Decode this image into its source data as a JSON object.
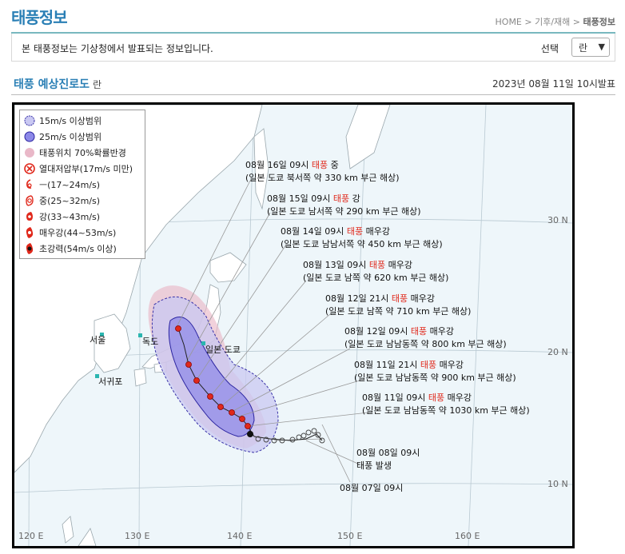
{
  "header": {
    "title": "태풍정보",
    "breadcrumb": [
      "HOME",
      "기후/재해",
      "태풍정보"
    ]
  },
  "notice": {
    "text": "본 태풍정보는 기상청에서 발표되는 정보입니다.",
    "select_label": "선택",
    "select_value": "란"
  },
  "section": {
    "title": "태풍 예상진로도",
    "typhoon_name": "란",
    "announced": "2023년 08월 11일 10시발표"
  },
  "legend": [
    {
      "label": "15m/s 이상범위",
      "icon": "circle-light-blue"
    },
    {
      "label": "25m/s 이상범위",
      "icon": "circle-blue"
    },
    {
      "label": "태풍위치 70%확률반경",
      "icon": "circle-pink"
    },
    {
      "label": "열대저압부(17m/s 미만)",
      "icon": "circle-x-icon"
    },
    {
      "label": "ㅡ(17~24m/s)",
      "icon": "typhoon-weak-icon"
    },
    {
      "label": "중(25~32m/s)",
      "icon": "typhoon-medium-icon"
    },
    {
      "label": "강(33~43m/s)",
      "icon": "typhoon-strong-icon"
    },
    {
      "label": "매우강(44~53m/s)",
      "icon": "typhoon-very-strong-icon"
    },
    {
      "label": "초강력(54m/s 이상)",
      "icon": "typhoon-super-icon"
    }
  ],
  "forecasts": [
    {
      "date": "08월 16일 09시",
      "kw": "태풍",
      "strength": "중",
      "loc": "(일본 도쿄 북서쪽 약 330 km 부근 해상)"
    },
    {
      "date": "08월 15일 09시",
      "kw": "태풍",
      "strength": "강",
      "loc": "(일본 도쿄 남서쪽 약 290 km 부근 해상)"
    },
    {
      "date": "08월 14일 09시",
      "kw": "태풍",
      "strength": "매우강",
      "loc": "(일본 도쿄 남남서쪽 약 450 km 부근 해상)"
    },
    {
      "date": "08월 13일 09시",
      "kw": "태풍",
      "strength": "매우강",
      "loc": "(일본 도쿄 남쪽 약 620 km 부근 해상)"
    },
    {
      "date": "08월 12일 21시",
      "kw": "태풍",
      "strength": "매우강",
      "loc": "(일본 도쿄 남쪽 약 710 km 부근 해상)"
    },
    {
      "date": "08월 12일 09시",
      "kw": "태풍",
      "strength": "매우강",
      "loc": "(일본 도쿄 남남동쪽 약 800 km 부근 해상)"
    },
    {
      "date": "08월 11일 21시",
      "kw": "태풍",
      "strength": "매우강",
      "loc": "(일본 도쿄 남남동쪽 약 900 km 부근 해상)"
    },
    {
      "date": "08월 11일 09시",
      "kw": "태풍",
      "strength": "매우강",
      "loc": "(일본 도쿄 남남동쪽 약 1030 km 부근 해상)"
    }
  ],
  "past": [
    {
      "date": "08월 08일 09시",
      "note": "태풍 발생"
    },
    {
      "date": "08월 07일 09시",
      "note": ""
    }
  ],
  "cities": [
    "서울",
    "독도",
    "일본 도쿄",
    "서귀포"
  ],
  "lat_labels": [
    "30 N",
    "20 N",
    "10 N"
  ],
  "lon_labels": [
    "120 E",
    "130 E",
    "140 E",
    "150 E",
    "160 E"
  ],
  "colors": {
    "accent": "#2a7fb5",
    "highlight": "#e0281b",
    "sea": "#eef6fa",
    "land": "#ffffff",
    "range15": "#c9c8f2",
    "range25": "#8c88e8",
    "prob70": "#e9b8c8"
  }
}
